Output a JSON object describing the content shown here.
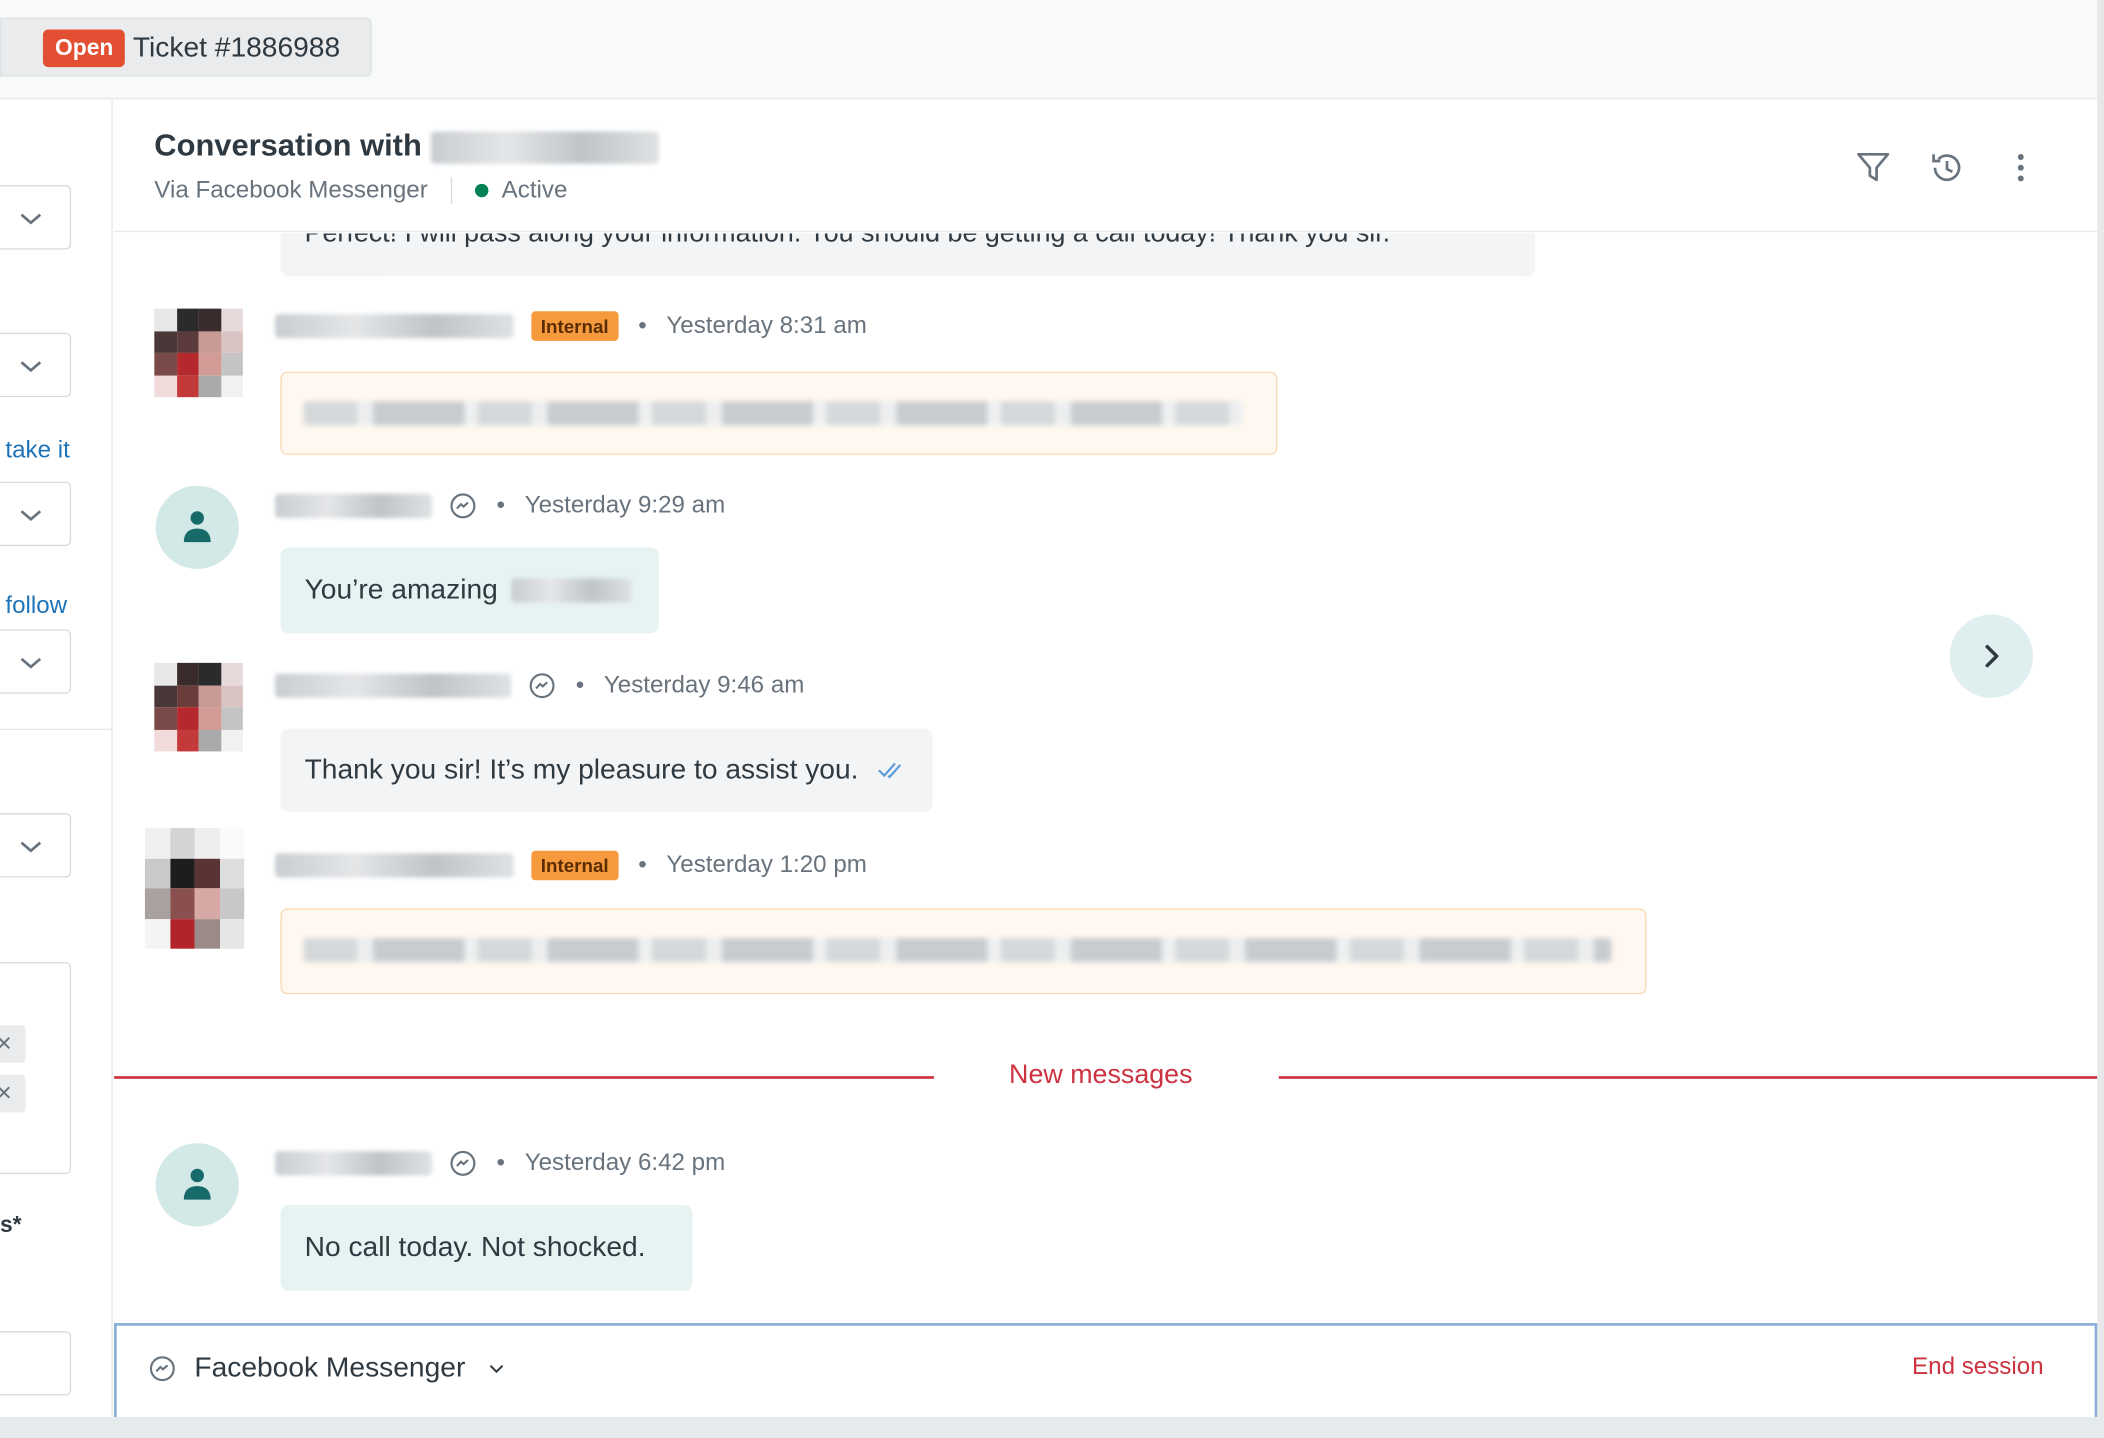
{
  "top_bar": {
    "status_badge": "Open",
    "ticket_title": "Ticket #1886988"
  },
  "left_panel": {
    "link_1": "take it",
    "link_2": "follow",
    "label_partial": "s*"
  },
  "header": {
    "title_prefix": "Conversation with",
    "channel": "Via Facebook Messenger",
    "status": "Active"
  },
  "messages": [
    {
      "type": "agent",
      "text": "Perfect! I will pass along your information. You should be getting a call today! Thank you sir."
    },
    {
      "type": "internal",
      "badge": "Internal",
      "time": "Yesterday 8:31 am"
    },
    {
      "type": "user",
      "time": "Yesterday 9:29 am",
      "text": "You’re amazing"
    },
    {
      "type": "agent",
      "time": "Yesterday 9:46 am",
      "text": "Thank you sir! It’s my pleasure to assist you."
    },
    {
      "type": "internal",
      "badge": "Internal",
      "time": "Yesterday 1:20 pm"
    },
    {
      "type": "user",
      "time": "Yesterday 6:42 pm",
      "text": "No call today. Not shocked."
    }
  ],
  "separator": "New messages",
  "composer": {
    "channel": "Facebook Messenger",
    "end_session": "End session"
  },
  "colors": {
    "open_badge": "#e34f32",
    "internal_badge": "#f79a3e",
    "active_dot": "#038153",
    "new_messages": "#cc3340",
    "link": "#1f73b7"
  }
}
